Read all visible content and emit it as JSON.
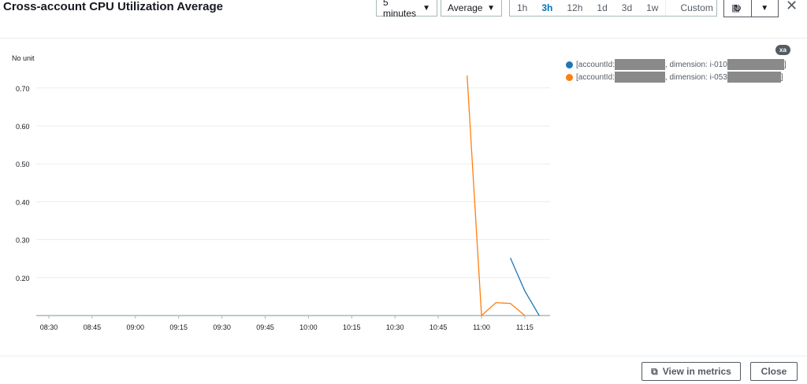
{
  "header": {
    "title": "Cross-account CPU Utilization Average",
    "period": "5 minutes",
    "statistic": "Average",
    "ranges": [
      "1h",
      "3h",
      "12h",
      "1d",
      "3d",
      "1w"
    ],
    "active_range": "3h",
    "custom_label": "Custom"
  },
  "legend": {
    "badge": "xa",
    "items": [
      {
        "prefix": "[accountId:",
        "mid": ", dimension: i-010",
        "suffix": "]",
        "color": "#1f77b4"
      },
      {
        "prefix": "[accountId:",
        "mid": ", dimension: i-053",
        "suffix": "]",
        "color": "#ff7f0e"
      }
    ]
  },
  "footer": {
    "view_metrics": "View in metrics",
    "close": "Close"
  },
  "chart_data": {
    "type": "line",
    "ylabel": "No unit",
    "ylim": [
      0.1,
      0.75
    ],
    "yticks": [
      "0.20",
      "0.30",
      "0.40",
      "0.50",
      "0.60",
      "0.70"
    ],
    "xticks": [
      "08:30",
      "08:45",
      "09:00",
      "09:15",
      "09:30",
      "09:45",
      "10:00",
      "10:15",
      "10:30",
      "10:45",
      "11:00",
      "11:15"
    ],
    "series": [
      {
        "name": "i-010",
        "color": "#1f77b4",
        "x": [
          "11:10",
          "11:15",
          "11:20"
        ],
        "values": [
          0.252,
          0.165,
          0.1
        ]
      },
      {
        "name": "i-053",
        "color": "#ff7f0e",
        "x": [
          "10:55",
          "11:00",
          "11:05",
          "11:10",
          "11:15"
        ],
        "values": [
          0.733,
          0.1,
          0.134,
          0.132,
          0.1
        ]
      }
    ]
  }
}
